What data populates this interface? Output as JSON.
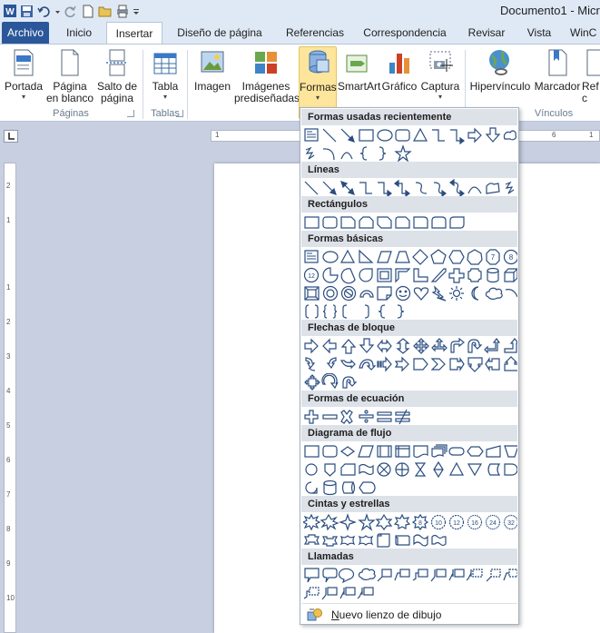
{
  "window": {
    "document_title": "Documento1 - Micr"
  },
  "qat": {
    "icons": [
      "word-logo-icon",
      "save-icon",
      "undo-icon",
      "dropdown-arrow-icon",
      "redo-icon",
      "new-document-icon",
      "open-folder-icon",
      "print-preview-icon",
      "customize-qat-icon"
    ]
  },
  "tabs": [
    {
      "label": "Archivo"
    },
    {
      "label": "Inicio"
    },
    {
      "label": "Insertar"
    },
    {
      "label": "Diseño de página"
    },
    {
      "label": "Referencias"
    },
    {
      "label": "Correspondencia"
    },
    {
      "label": "Revisar"
    },
    {
      "label": "Vista"
    },
    {
      "label": "WinC"
    }
  ],
  "ribbon": {
    "buttons": {
      "portada": "Portada",
      "pagina_blanco_1": "Página",
      "pagina_blanco_2": "en blanco",
      "salto_1": "Salto de",
      "salto_2": "página",
      "tabla": "Tabla",
      "imagen": "Imagen",
      "imagenes_1": "Imágenes",
      "imagenes_2": "prediseñadas",
      "formas": "Formas",
      "smartart": "SmartArt",
      "grafico": "Gráfico",
      "captura": "Captura",
      "hipervinculo": "Hipervínculo",
      "marcador": "Marcador",
      "ref": "Ref",
      "cruz": "c"
    },
    "groups": {
      "paginas": "Páginas",
      "tablas": "Tablas",
      "vinculos": "Vínculos"
    }
  },
  "ruler": {
    "horizontal_numbers": [
      "1",
      "6",
      "1"
    ],
    "vertical_numbers": [
      "2",
      "1",
      "1",
      "2",
      "3",
      "4",
      "5",
      "6",
      "7",
      "8",
      "9",
      "10"
    ]
  },
  "shapes_menu": {
    "sections": {
      "recientes": "Formas usadas recientemente",
      "lineas": "Líneas",
      "rectangulos": "Rectángulos",
      "basicas": "Formas básicas",
      "flechas": "Flechas de bloque",
      "ecuacion": "Formas de ecuación",
      "flujo": "Diagrama de flujo",
      "cintas": "Cintas y estrellas",
      "llamadas": "Llamadas"
    },
    "badges": {
      "n7": "7",
      "n8": "8",
      "n10": "10",
      "n12": "12",
      "n16": "16",
      "n24": "24",
      "n32": "32"
    },
    "footer_label": "Nuevo lienzo de dibujo"
  },
  "colors": {
    "file_tab": "#2b579a",
    "selected_button": "#fde59b",
    "header_band": "#dde1e8",
    "icon_stroke": "#2a4d80"
  }
}
